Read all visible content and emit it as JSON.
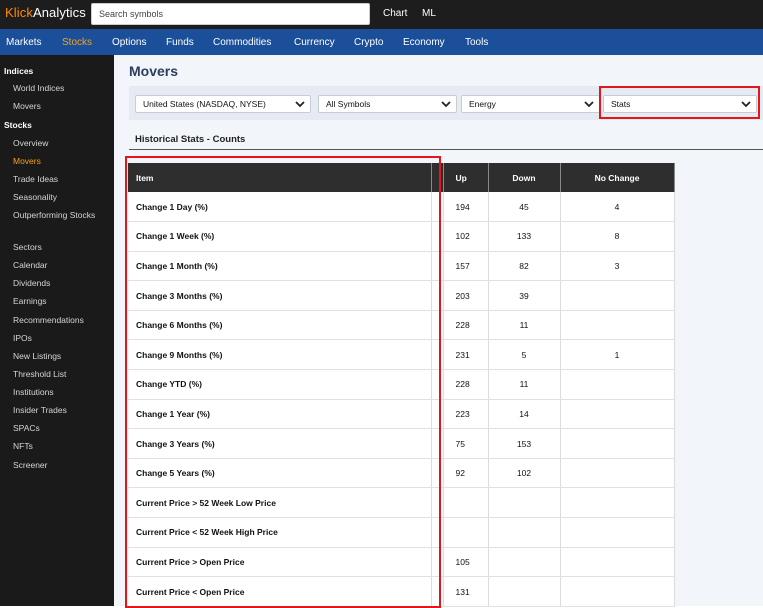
{
  "app": {
    "brand_prefix": "Klick",
    "brand_rest": "Analytics"
  },
  "search": {
    "placeholder": "Search symbols"
  },
  "top_links": [
    "Chart",
    "ML"
  ],
  "nav": [
    "Markets",
    "Stocks",
    "Options",
    "Funds",
    "Commodities",
    "Currency",
    "Crypto",
    "Economy",
    "Tools"
  ],
  "nav_active": "Stocks",
  "sidebar": {
    "indices_header": "Indices",
    "indices": [
      "World Indices",
      "Movers"
    ],
    "stocks_header": "Stocks",
    "stocks": [
      "Overview",
      "Movers",
      "Trade Ideas",
      "Seasonality",
      "Outperforming Stocks",
      "Sectors",
      "Calendar",
      "Dividends",
      "Earnings",
      "Recommendations",
      "IPOs",
      "New Listings",
      "Threshold List",
      "Institutions",
      "Insider Trades",
      "SPACs",
      "NFTs",
      "Screener"
    ],
    "active": "Movers"
  },
  "page": {
    "title": "Movers"
  },
  "filters": {
    "market": "United States (NASDAQ, NYSE)",
    "symbols": "All Symbols",
    "sector": "Energy",
    "view": "Stats"
  },
  "section": {
    "title": "Historical Stats - Counts"
  },
  "table": {
    "headers": [
      "Item",
      "",
      "Up",
      "Down",
      "No Change"
    ],
    "rows": [
      {
        "item": "Change 1 Day (%)",
        "up": "194",
        "down": "45",
        "nochange": "4"
      },
      {
        "item": "Change 1 Week (%)",
        "up": "102",
        "down": "133",
        "nochange": "8"
      },
      {
        "item": "Change 1 Month (%)",
        "up": "157",
        "down": "82",
        "nochange": "3"
      },
      {
        "item": "Change 3 Months (%)",
        "up": "203",
        "down": "39",
        "nochange": ""
      },
      {
        "item": "Change 6 Months (%)",
        "up": "228",
        "down": "11",
        "nochange": ""
      },
      {
        "item": "Change 9 Months (%)",
        "up": "231",
        "down": "5",
        "nochange": "1"
      },
      {
        "item": "Change YTD (%)",
        "up": "228",
        "down": "11",
        "nochange": ""
      },
      {
        "item": "Change 1 Year (%)",
        "up": "223",
        "down": "14",
        "nochange": ""
      },
      {
        "item": "Change 3 Years (%)",
        "up": "75",
        "down": "153",
        "nochange": ""
      },
      {
        "item": "Change 5 Years (%)",
        "up": "92",
        "down": "102",
        "nochange": ""
      },
      {
        "item": "Current Price > 52 Week Low Price",
        "up": "",
        "down": "",
        "nochange": ""
      },
      {
        "item": "Current Price < 52 Week High Price",
        "up": "",
        "down": "",
        "nochange": ""
      },
      {
        "item": "Current Price > Open Price",
        "up": "105",
        "down": "",
        "nochange": ""
      },
      {
        "item": "Current Price < Open Price",
        "up": "131",
        "down": "",
        "nochange": ""
      }
    ]
  },
  "colors": {
    "brand_accent": "#ff8c00",
    "nav_bg": "#1b4f9a",
    "active_nav": "#f7a21a",
    "highlight": "#e4161b"
  }
}
